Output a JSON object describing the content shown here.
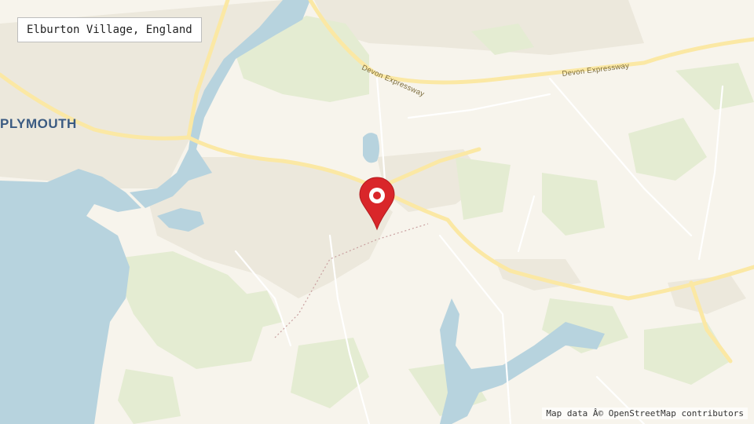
{
  "location": {
    "name": "Elburton Village, England"
  },
  "labels": {
    "city": "PLYMOUTH",
    "road_west": "Devon Expressway",
    "road_east": "Devon Expressway"
  },
  "attribution": "Map data Â© OpenStreetMap contributors",
  "marker": {
    "icon": "map-pin-icon",
    "color": "#d9262a"
  },
  "colors": {
    "land": "#f7f4ec",
    "water": "#b7d3de",
    "park": "#e4ecd2",
    "urban": "#ece8dc",
    "road_major": "#fbe8a4"
  }
}
